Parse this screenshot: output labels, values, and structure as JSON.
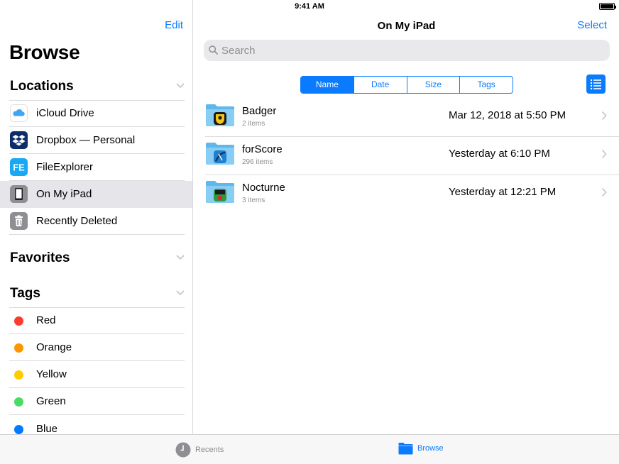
{
  "status_bar": {
    "time": "9:41 AM"
  },
  "sidebar": {
    "edit_label": "Edit",
    "title": "Browse",
    "locations_header": "Locations",
    "locations": [
      {
        "label": "iCloud Drive",
        "icon": "icloud-icon"
      },
      {
        "label": "Dropbox — Personal",
        "icon": "dropbox-icon"
      },
      {
        "label": "FileExplorer",
        "icon": "fileexplorer-icon"
      },
      {
        "label": "On My iPad",
        "icon": "ipad-icon",
        "selected": true
      },
      {
        "label": "Recently Deleted",
        "icon": "trash-icon"
      }
    ],
    "favorites_header": "Favorites",
    "tags_header": "Tags",
    "tags": [
      {
        "label": "Red",
        "color": "#ff3b30"
      },
      {
        "label": "Orange",
        "color": "#ff9500"
      },
      {
        "label": "Yellow",
        "color": "#ffcc00"
      },
      {
        "label": "Green",
        "color": "#4cd964"
      },
      {
        "label": "Blue",
        "color": "#007aff"
      }
    ]
  },
  "main": {
    "title": "On My iPad",
    "select_label": "Select",
    "search_placeholder": "Search",
    "sort_tabs": [
      "Name",
      "Date",
      "Size",
      "Tags"
    ],
    "active_sort": "Name",
    "files": [
      {
        "name": "Badger",
        "count": "2 items",
        "date": "Mar 12, 2018 at 5:50 PM",
        "badge": "badger-app-icon"
      },
      {
        "name": "forScore",
        "count": "296 items",
        "date": "Yesterday at 6:10 PM",
        "badge": "forscore-app-icon"
      },
      {
        "name": "Nocturne",
        "count": "3 items",
        "date": "Yesterday at 12:21 PM",
        "badge": "nocturne-app-icon"
      }
    ]
  },
  "tab_bar": {
    "recents_label": "Recents",
    "browse_label": "Browse",
    "active": "Browse"
  },
  "colors": {
    "accent": "#0a7aff"
  }
}
